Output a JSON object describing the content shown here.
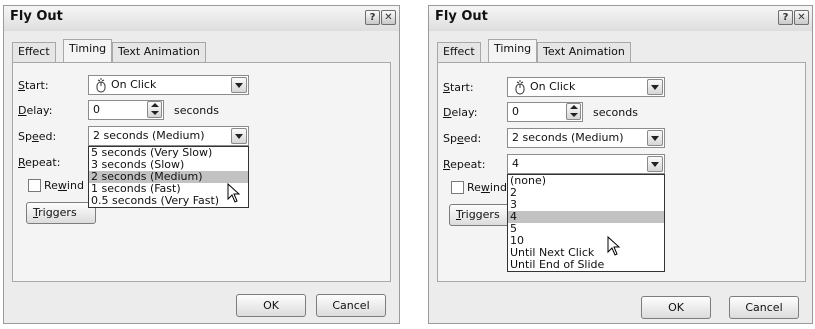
{
  "left_dialog": {
    "title": "Fly Out",
    "help_glyph": "?",
    "close_glyph": "✕",
    "tabs": [
      "Effect",
      "Timing",
      "Text Animation"
    ],
    "active_tab": "Timing",
    "start": {
      "label_u": "S",
      "label_rest": "tart:",
      "value": "On Click",
      "icon": "mouse-click-icon"
    },
    "delay": {
      "label_u": "D",
      "label_rest": "elay:",
      "value": "0",
      "unit": "seconds"
    },
    "speed": {
      "label_pre": "Sp",
      "label_u": "e",
      "label_rest": "ed:",
      "value": "2 seconds (Medium)"
    },
    "repeat": {
      "label_u": "R",
      "label_rest": "epeat:"
    },
    "rewind": {
      "label_pre": "Re",
      "label_u": "w",
      "label_rest": "ind"
    },
    "triggers": {
      "label_u": "T",
      "label_rest": "riggers"
    },
    "speed_options": [
      "5 seconds (Very Slow)",
      "3 seconds (Slow)",
      "2 seconds (Medium)",
      "1 seconds (Fast)",
      "0.5 seconds (Very Fast)"
    ],
    "speed_selected": "2 seconds (Medium)",
    "ok": "OK",
    "cancel": "Cancel"
  },
  "right_dialog": {
    "title": "Fly Out",
    "help_glyph": "?",
    "close_glyph": "✕",
    "tabs": [
      "Effect",
      "Timing",
      "Text Animation"
    ],
    "active_tab": "Timing",
    "start": {
      "label_u": "S",
      "label_rest": "tart:",
      "value": "On Click",
      "icon": "mouse-click-icon"
    },
    "delay": {
      "label_u": "D",
      "label_rest": "elay:",
      "value": "0",
      "unit": "seconds"
    },
    "speed": {
      "label_pre": "Sp",
      "label_u": "e",
      "label_rest": "ed:",
      "value": "2 seconds (Medium)"
    },
    "repeat": {
      "label_u": "R",
      "label_rest": "epeat:",
      "value": "4"
    },
    "rewind": {
      "label_pre": "Re",
      "label_u": "w",
      "label_rest": "ind"
    },
    "triggers": {
      "label_u": "T",
      "label_rest": "riggers"
    },
    "repeat_options": [
      "(none)",
      "2",
      "3",
      "4",
      "5",
      "10",
      "Until Next Click",
      "Until End of Slide"
    ],
    "repeat_selected": "4",
    "ok": "OK",
    "cancel": "Cancel"
  },
  "colors": {
    "dialog_bg": "#ececec",
    "selected_item": "#c2c2c2"
  }
}
